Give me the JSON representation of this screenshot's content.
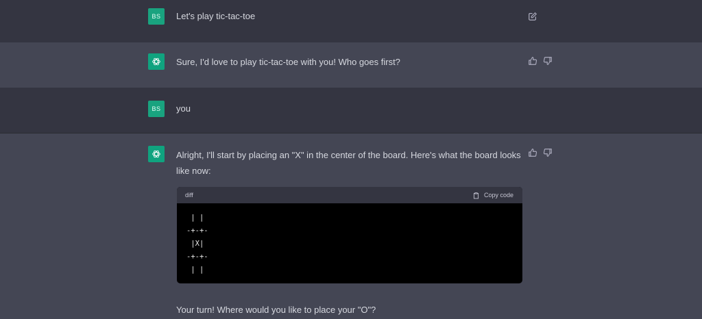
{
  "messages": [
    {
      "role": "user",
      "avatar_initials": "BS",
      "text": "Let's play tic-tac-toe"
    },
    {
      "role": "assistant",
      "text": "Sure, I'd love to play tic-tac-toe with you! Who goes first?"
    },
    {
      "role": "user",
      "avatar_initials": "BS",
      "text": "you"
    },
    {
      "role": "assistant",
      "text": "Alright, I'll start by placing an \"X\" in the center of the board. Here's what the board looks like now:",
      "code": {
        "language": "diff",
        "copy_label": "Copy code",
        "content": " | |\n-+-+-\n |X|\n-+-+-\n | |"
      },
      "text_after": "Your turn! Where would you like to place your \"O\"?"
    }
  ],
  "icons": {
    "edit": "edit-icon",
    "thumbs_up": "thumbs-up-icon",
    "thumbs_down": "thumbs-down-icon",
    "copy": "clipboard-icon",
    "logo": "openai-logo-icon"
  },
  "colors": {
    "user_bg": "#343541",
    "assistant_bg": "#444654",
    "avatar_green": "#10a37f",
    "code_bg": "#000000"
  }
}
